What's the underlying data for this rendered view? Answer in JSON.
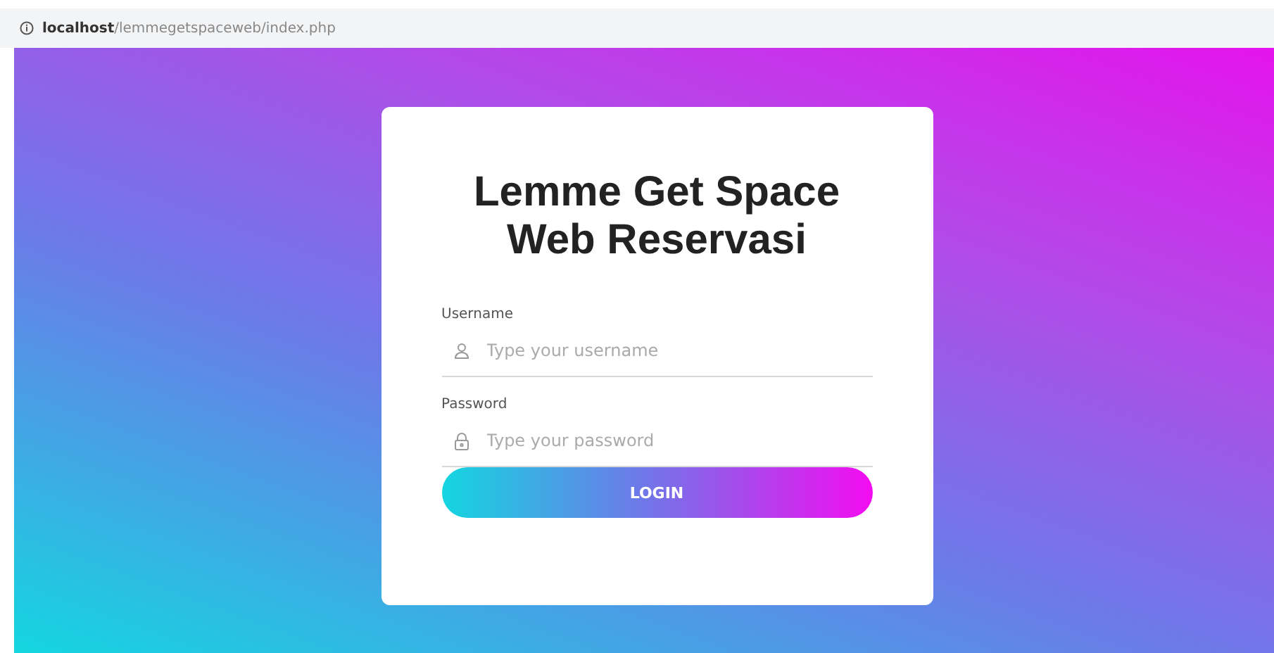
{
  "address_bar": {
    "host": "localhost",
    "path": "/lemmegetspaceweb/index.php"
  },
  "login_card": {
    "title": "Lemme Get Space Web Reservasi",
    "fields": [
      {
        "kind": "user",
        "label": "Username",
        "placeholder": "Type your username"
      },
      {
        "kind": "lock",
        "label": "Password",
        "placeholder": "Type your password"
      }
    ],
    "button": "LOGIN"
  }
}
